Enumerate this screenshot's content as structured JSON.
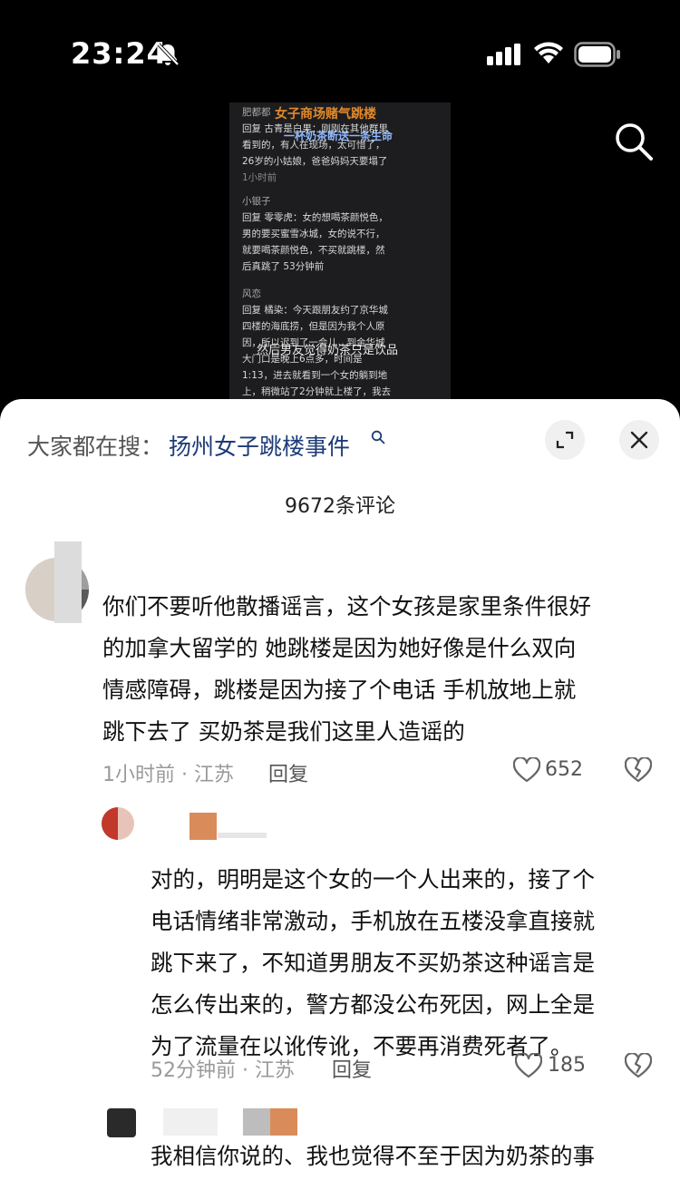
{
  "status_bar": {
    "time": "23:24"
  },
  "video": {
    "headline": "女子商场赌气跳楼",
    "subline": "一杯奶茶断送一条生命",
    "comments": [
      {
        "name": "肥都都",
        "lines": [
          "回复 古青是白果：刚刚在其他群里",
          "看到的，有人在现场，太可惜了，",
          "26岁的小姑娘，爸爸妈妈天要塌了"
        ],
        "meta": "1小时前"
      },
      {
        "name": "小银子",
        "lines": [
          "回复 零零虎：女的想喝茶颜悦色，",
          "男的要买蜜雪冰城，女的说不行，",
          "就要喝茶颜悦色，不买就跳楼，然",
          "后真跳了 53分钟前"
        ],
        "meta": ""
      },
      {
        "name": "风恋",
        "lines": [
          "回复 橘染：今天跟朋友约了京华城",
          "四楼的海底捞，但是因为我个人原",
          "因，所以迟到了一会儿，到金华城",
          "大门口是晚上6点多，时间是",
          "1:13，进去就看到一个女的躺到地",
          "上，稍微站了2分钟就上楼了，我去"
        ],
        "meta": ""
      }
    ],
    "overlay": "然后男友觉得奶茶只是饮品"
  },
  "sheet": {
    "search_prefix": "大家都在搜：",
    "search_term": "扬州女子跳楼事件",
    "comment_count": "9672条评论"
  },
  "comments": [
    {
      "lines": [
        "你们不要听他散播谣言，这个女孩是家里条件很好",
        "的加拿大留学的 她跳楼是因为她好像是什么双向",
        "情感障碍，跳楼是因为接了个电话 手机放地上就",
        "跳下去了 买奶茶是我们这里人造谣的"
      ],
      "meta": "1小时前 · 江苏",
      "reply": "回复",
      "likes": "652"
    },
    {
      "lines": [
        "对的，明明是这个女的一个人出来的，接了个",
        "电话情绪非常激动，手机放在五楼没拿直接就",
        "跳下来了，不知道男朋友不买奶茶这种谣言是",
        "怎么传出来的，警方都没公布死因，网上全是",
        "为了流量在以讹传讹，不要再消费死者了。"
      ],
      "meta": "52分钟前 · 江苏",
      "reply": "回复",
      "likes": "185"
    },
    {
      "lines": [
        "我相信你说的、我也觉得不至于因为奶茶的事"
      ]
    }
  ],
  "colors": {
    "sheet_bg": "#ffffff",
    "link": "#1d3b78",
    "meta": "#9a9a9a"
  },
  "icons": [
    "bell-off-icon",
    "signal-icon",
    "wifi-icon",
    "battery-icon",
    "search-icon",
    "expand-icon",
    "close-icon",
    "heart-icon",
    "broken-heart-icon"
  ]
}
